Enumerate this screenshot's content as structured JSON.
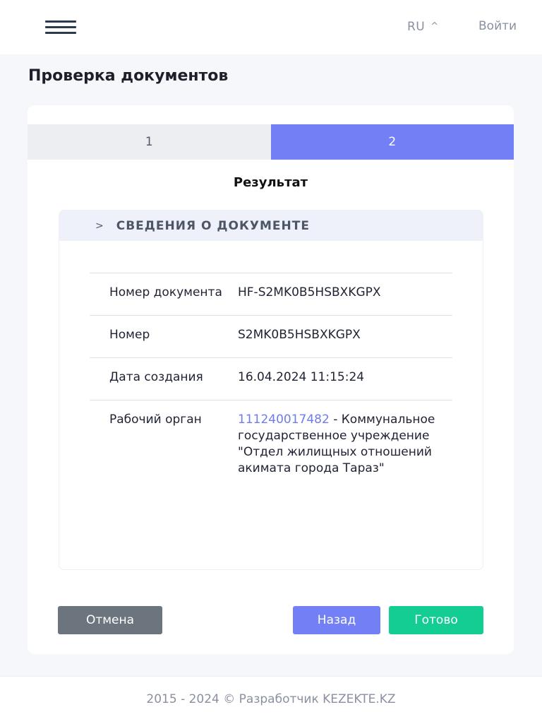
{
  "header": {
    "language": "RU",
    "login_label": "Войти"
  },
  "page": {
    "title": "Проверка документов"
  },
  "steps": [
    {
      "label": "1",
      "active": false
    },
    {
      "label": "2",
      "active": true
    }
  ],
  "result": {
    "title": "Результат",
    "panel_title": "СВЕДЕНИЯ О ДОКУМЕНТЕ",
    "rows": [
      {
        "label": "Номер документа",
        "value": "HF-S2MK0B5HSBXKGPX"
      },
      {
        "label": "Номер",
        "value": "S2MK0B5HSBXKGPX"
      },
      {
        "label": "Дата создания",
        "value": "16.04.2024 11:15:24"
      },
      {
        "label": "Рабочий орган",
        "link": "111240017482",
        "value": " - Коммунальное государственное учреждение \"Отдел жилищных отношений акимата города Тараз\""
      }
    ]
  },
  "buttons": {
    "cancel": "Отмена",
    "back": "Назад",
    "done": "Готово"
  },
  "footer": {
    "text": "2015 - 2024 © Разработчик KEZEKTE.KZ"
  },
  "colors": {
    "accent": "#7380f5",
    "success": "#13cd93",
    "secondary": "#6c757d",
    "link": "#6f7cf0"
  },
  "icons": {
    "menu": "hamburger-menu-icon",
    "language_toggle": "chevron-up-icon",
    "panel_toggle": "chevron-right-icon"
  }
}
